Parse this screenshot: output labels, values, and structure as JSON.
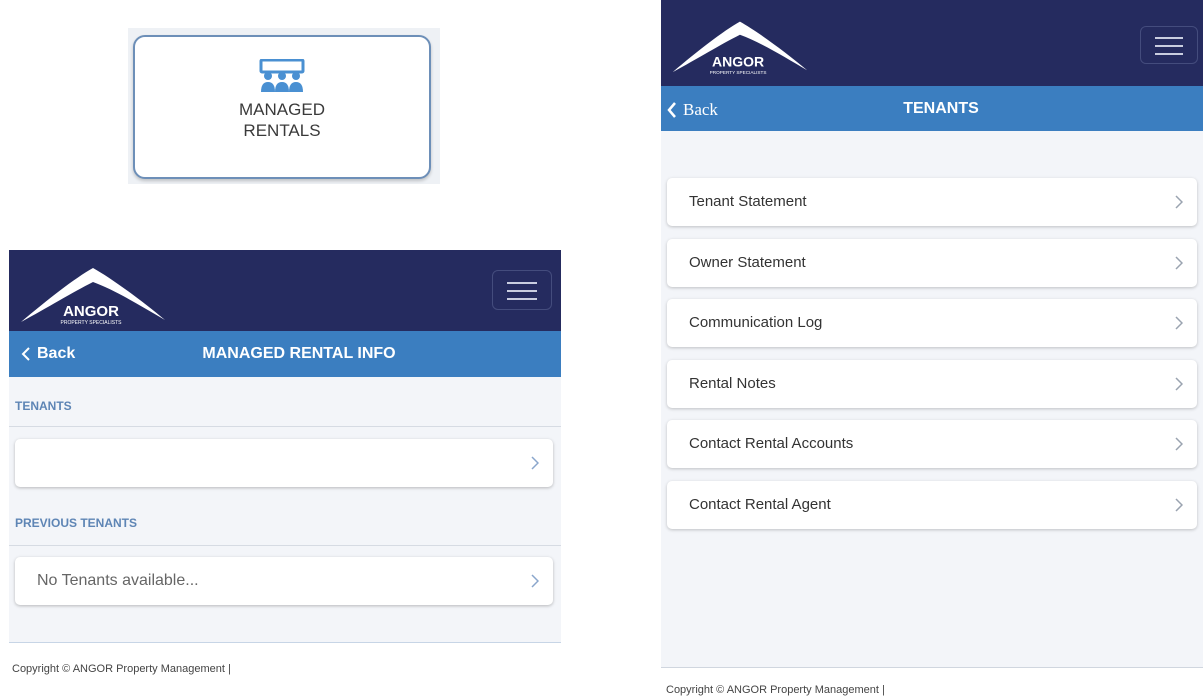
{
  "tile": {
    "label_line1": "MANAGED",
    "label_line2": "RENTALS",
    "icon": "people-group-icon"
  },
  "brand": {
    "name": "ANGOR",
    "tagline": "PROPERTY SPECIALISTS",
    "menu_icon": "hamburger-menu-icon"
  },
  "left_screen": {
    "back_label": "Back",
    "title": "MANAGED RENTAL INFO",
    "tenants_section": "TENANTS",
    "tenants_item": "",
    "previous_section": "PREVIOUS TENANTS",
    "previous_item": "No Tenants available...",
    "copyright": "Copyright © ANGOR Property Management |"
  },
  "right_screen": {
    "back_label": "Back",
    "title": "TENANTS",
    "items": [
      {
        "label": "Tenant Statement"
      },
      {
        "label": "Owner Statement"
      },
      {
        "label": "Communication Log"
      },
      {
        "label": "Rental Notes"
      },
      {
        "label": "Contact Rental Accounts"
      },
      {
        "label": "Contact Rental Agent"
      }
    ],
    "copyright": "Copyright © ANGOR Property Management |"
  },
  "colors": {
    "header_navy": "#252b5f",
    "subbar_blue": "#3b7ec0",
    "section_label_blue": "#5e85b5",
    "background": "#f3f5f9"
  }
}
